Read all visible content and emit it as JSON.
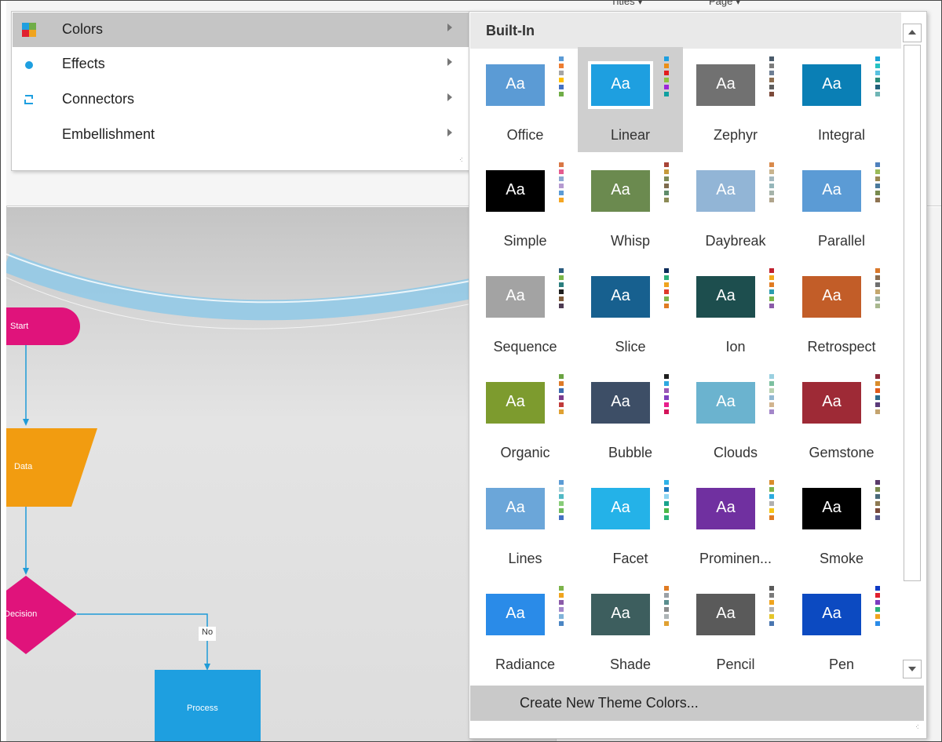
{
  "colors": {
    "menu_active_bg": "#c5c5c5",
    "accent_blue": "#1e9fe0",
    "start_shape": "#e0137b",
    "data_shape": "#f29c10",
    "decision_shape": "#e0137b",
    "process_shape": "#1e9fe0",
    "connector_line": "#1f9bd7"
  },
  "ribbon": {
    "labels": [
      "Titles ▾",
      "Page ▾"
    ]
  },
  "menu": {
    "items": [
      {
        "label": "Colors",
        "underline": "C",
        "icon": "colors-icon",
        "active": true
      },
      {
        "label": "Effects",
        "underline": "E",
        "icon": "effects-dot-icon",
        "active": false
      },
      {
        "label": "Connectors",
        "underline": "C",
        "icon": "connectors-icon",
        "active": false
      },
      {
        "label": "Embellishment",
        "underline": "E",
        "icon": "",
        "active": false
      }
    ]
  },
  "gallery": {
    "header": "Built-In",
    "create_button": "Create New Theme Colors...",
    "themes": [
      {
        "name": "Office",
        "main": "#5b9bd5",
        "text": "#ffffff",
        "stripes": [
          "#5b9bd5",
          "#ed7d31",
          "#a5a5a5",
          "#ffc000",
          "#4472c4",
          "#70ad47"
        ]
      },
      {
        "name": "Linear",
        "main": "#1e9fe0",
        "text": "#ffffff",
        "stripes": [
          "#1e9fe0",
          "#eb8f16",
          "#e21d1d",
          "#8ec43f",
          "#9c26d9",
          "#10a0a0"
        ],
        "selected": true
      },
      {
        "name": "Zephyr",
        "main": "#717171",
        "text": "#ffffff",
        "stripes": [
          "#4a5a6a",
          "#7b7b7b",
          "#6d7e94",
          "#8c6d4f",
          "#5e5e5e",
          "#7c4a3a"
        ]
      },
      {
        "name": "Integral",
        "main": "#0a7fb5",
        "text": "#ffffff",
        "stripes": [
          "#1aa3d6",
          "#27c2c2",
          "#59c1e0",
          "#2a8c7a",
          "#22617a",
          "#6fb5b5"
        ]
      },
      {
        "name": "Simple",
        "main": "#000000",
        "text": "#ffffff",
        "stripes": [
          "#d97745",
          "#e55b8e",
          "#8da8d2",
          "#b59ad0",
          "#5b9bd5",
          "#f5a623"
        ]
      },
      {
        "name": "Whisp",
        "main": "#6b8a4f",
        "text": "#ffffff",
        "stripes": [
          "#a84437",
          "#c69a3c",
          "#7c8a57",
          "#7e6b4e",
          "#5f8c6a",
          "#8c8b55"
        ]
      },
      {
        "name": "Daybreak",
        "main": "#92b5d6",
        "text": "#ffffff",
        "stripes": [
          "#d98a4c",
          "#c9b48e",
          "#a3b8c0",
          "#95b6ba",
          "#a5b3aa",
          "#b0a58c"
        ]
      },
      {
        "name": "Parallel",
        "main": "#5b9bd5",
        "text": "#ffffff",
        "stripes": [
          "#4f81bd",
          "#9bbb59",
          "#9a8750",
          "#4b7a9c",
          "#788a4e",
          "#8e7352"
        ]
      },
      {
        "name": "Sequence",
        "main": "#a3a3a3",
        "text": "#ffffff",
        "stripes": [
          "#2b5b7e",
          "#7ab648",
          "#2b7e7e",
          "#1e1e1e",
          "#7e5b3a",
          "#4d3a52"
        ]
      },
      {
        "name": "Slice",
        "main": "#17608f",
        "text": "#ffffff",
        "stripes": [
          "#0e2d5b",
          "#2cb07a",
          "#f0a41e",
          "#e03a2b",
          "#7db34a",
          "#e07b22"
        ]
      },
      {
        "name": "Ion",
        "main": "#1d4e4e",
        "text": "#ffffff",
        "stripes": [
          "#c0202e",
          "#f2a81a",
          "#e07b22",
          "#2b9cb0",
          "#7ab648",
          "#8a5aa8"
        ]
      },
      {
        "name": "Retrospect",
        "main": "#c25d28",
        "text": "#ffffff",
        "stripes": [
          "#d9782b",
          "#8c6d4f",
          "#6f6f6f",
          "#c4a76e",
          "#9fb2a2",
          "#a9b88f"
        ]
      },
      {
        "name": "Organic",
        "main": "#7d9b2e",
        "text": "#ffffff",
        "stripes": [
          "#6aa342",
          "#de7a28",
          "#3b6bb0",
          "#7b3c8c",
          "#c03a3a",
          "#e0a132"
        ]
      },
      {
        "name": "Bubble",
        "main": "#3d4e66",
        "text": "#ffffff",
        "stripes": [
          "#1e1e1e",
          "#2da9e0",
          "#9b59b6",
          "#7f3fbf",
          "#e91e8c",
          "#d4145a"
        ]
      },
      {
        "name": "Clouds",
        "main": "#6bb3cf",
        "text": "#ffffff",
        "stripes": [
          "#9ad0e0",
          "#7cc0a0",
          "#b8d1b0",
          "#92b8d2",
          "#d1b48e",
          "#a386c9"
        ]
      },
      {
        "name": "Gemstone",
        "main": "#9e2a36",
        "text": "#ffffff",
        "stripes": [
          "#8c2a3a",
          "#d98c2b",
          "#e05a1b",
          "#2b6b8c",
          "#5b3a7a",
          "#c4a36e"
        ]
      },
      {
        "name": "Lines",
        "main": "#6ba6d9",
        "text": "#ffffff",
        "stripes": [
          "#5b9bd5",
          "#a6d0d9",
          "#50b8c4",
          "#88cc79",
          "#6fb95c",
          "#4472c4"
        ]
      },
      {
        "name": "Facet",
        "main": "#24b2e8",
        "text": "#ffffff",
        "stripes": [
          "#2fb2e8",
          "#1e7ac4",
          "#8fd6f2",
          "#19a38c",
          "#4cb848",
          "#2bb37a"
        ]
      },
      {
        "name": "Prominen...",
        "main": "#7030a0",
        "text": "#ffffff",
        "stripes": [
          "#d98c2b",
          "#7cb34a",
          "#2cabdf",
          "#b0b0b0",
          "#f5c418",
          "#e07b22"
        ]
      },
      {
        "name": "Smoke",
        "main": "#000000",
        "text": "#ffffff",
        "stripes": [
          "#5a3a6a",
          "#7b8a4e",
          "#4a6a7a",
          "#8e7a52",
          "#7a4a3a",
          "#5a5a8a"
        ]
      },
      {
        "name": "Radiance",
        "main": "#2a8be8",
        "text": "#ffffff",
        "stripes": [
          "#7cb34a",
          "#f0a41e",
          "#8a5aa8",
          "#a387c9",
          "#7fb3d9",
          "#4b86c4"
        ]
      },
      {
        "name": "Shade",
        "main": "#3d5e5e",
        "text": "#ffffff",
        "stripes": [
          "#e07b22",
          "#9aa0a6",
          "#5a8e8e",
          "#8c8c8c",
          "#aeb4b6",
          "#e0a132"
        ]
      },
      {
        "name": "Pencil",
        "main": "#5a5a5a",
        "text": "#ffffff",
        "stripes": [
          "#5a5a5a",
          "#7a7a7a",
          "#f0a41e",
          "#b0b0b0",
          "#e5c52a",
          "#4a76b0"
        ]
      },
      {
        "name": "Pen",
        "main": "#0c4ac1",
        "text": "#ffffff",
        "stripes": [
          "#0e3ac4",
          "#e0202e",
          "#7b3cbf",
          "#2bb37a",
          "#f0a41e",
          "#2a8be8"
        ]
      }
    ]
  },
  "diagram": {
    "start": "Start",
    "data": "Data",
    "decision": "Decision",
    "process": "Process",
    "no_label": "No"
  }
}
